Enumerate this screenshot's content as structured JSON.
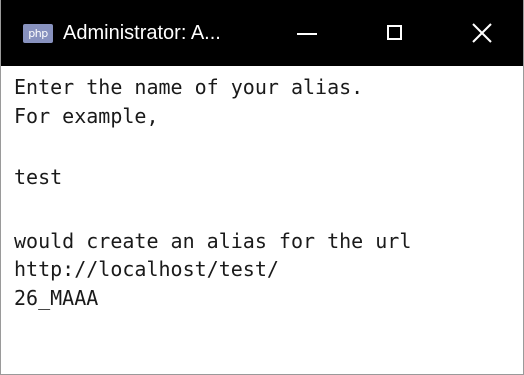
{
  "window": {
    "icon_text": "php",
    "title": "Administrator:  A..."
  },
  "console": {
    "lines": [
      "Enter the name of your alias.",
      "For example,",
      "",
      "test",
      "",
      "would create an alias for the url",
      "http://localhost/test/",
      "26_MAAA"
    ]
  },
  "icons": {
    "app": "php-icon",
    "minimize": "minimize-icon",
    "maximize": "maximize-icon",
    "close": "close-icon"
  },
  "colors": {
    "titlebar_bg": "#000000",
    "titlebar_text": "#ffffff",
    "console_bg": "#ffffff",
    "console_text": "#1a1a1a",
    "php_icon": "#8892bf"
  }
}
